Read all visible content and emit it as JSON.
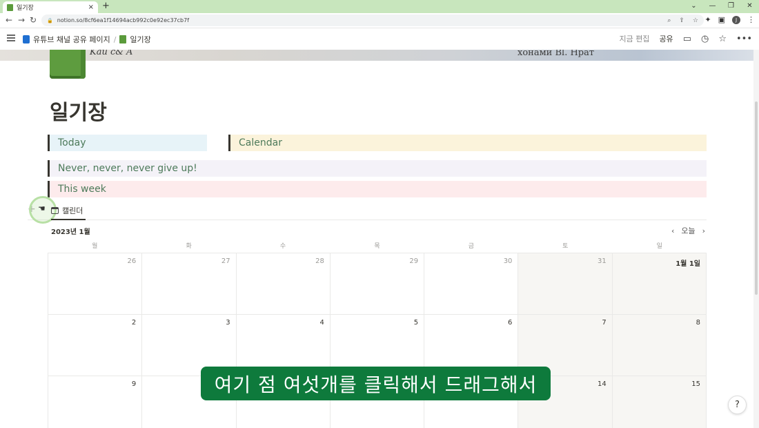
{
  "browser": {
    "tab_title": "일기장",
    "tab_close": "×",
    "new_tab": "+",
    "url": "notion.so/8cf6ea1f14694acb992c0e92ec37cb7f",
    "avatar_letter": "J"
  },
  "notion_topbar": {
    "breadcrumb_1": "유튜브 채널 공유 페이지",
    "breadcrumb_sep": "/",
    "breadcrumb_2": "일기장",
    "edit_time": "지금 편집",
    "share": "공유"
  },
  "cover": {
    "text_1": "Kau   c&   A",
    "text_2": "хонами    Bl. Нрат"
  },
  "page": {
    "title": "일기장",
    "callouts": [
      "Today",
      "Calendar",
      "Never, never, never give up!",
      "This week"
    ]
  },
  "database": {
    "view_label": "캘린더",
    "month": "2023년 1월",
    "today_button": "오늘",
    "weekdays": [
      "월",
      "화",
      "수",
      "목",
      "금",
      "토",
      "일"
    ],
    "days": [
      "26",
      "27",
      "28",
      "29",
      "30",
      "31",
      "1월 1일",
      "2",
      "3",
      "4",
      "5",
      "6",
      "7",
      "8",
      "9",
      "",
      "",
      "",
      "",
      "14",
      "15"
    ]
  },
  "subtitle": "여기 점 여섯개를 클릭해서 드래그해서",
  "help_label": "?"
}
